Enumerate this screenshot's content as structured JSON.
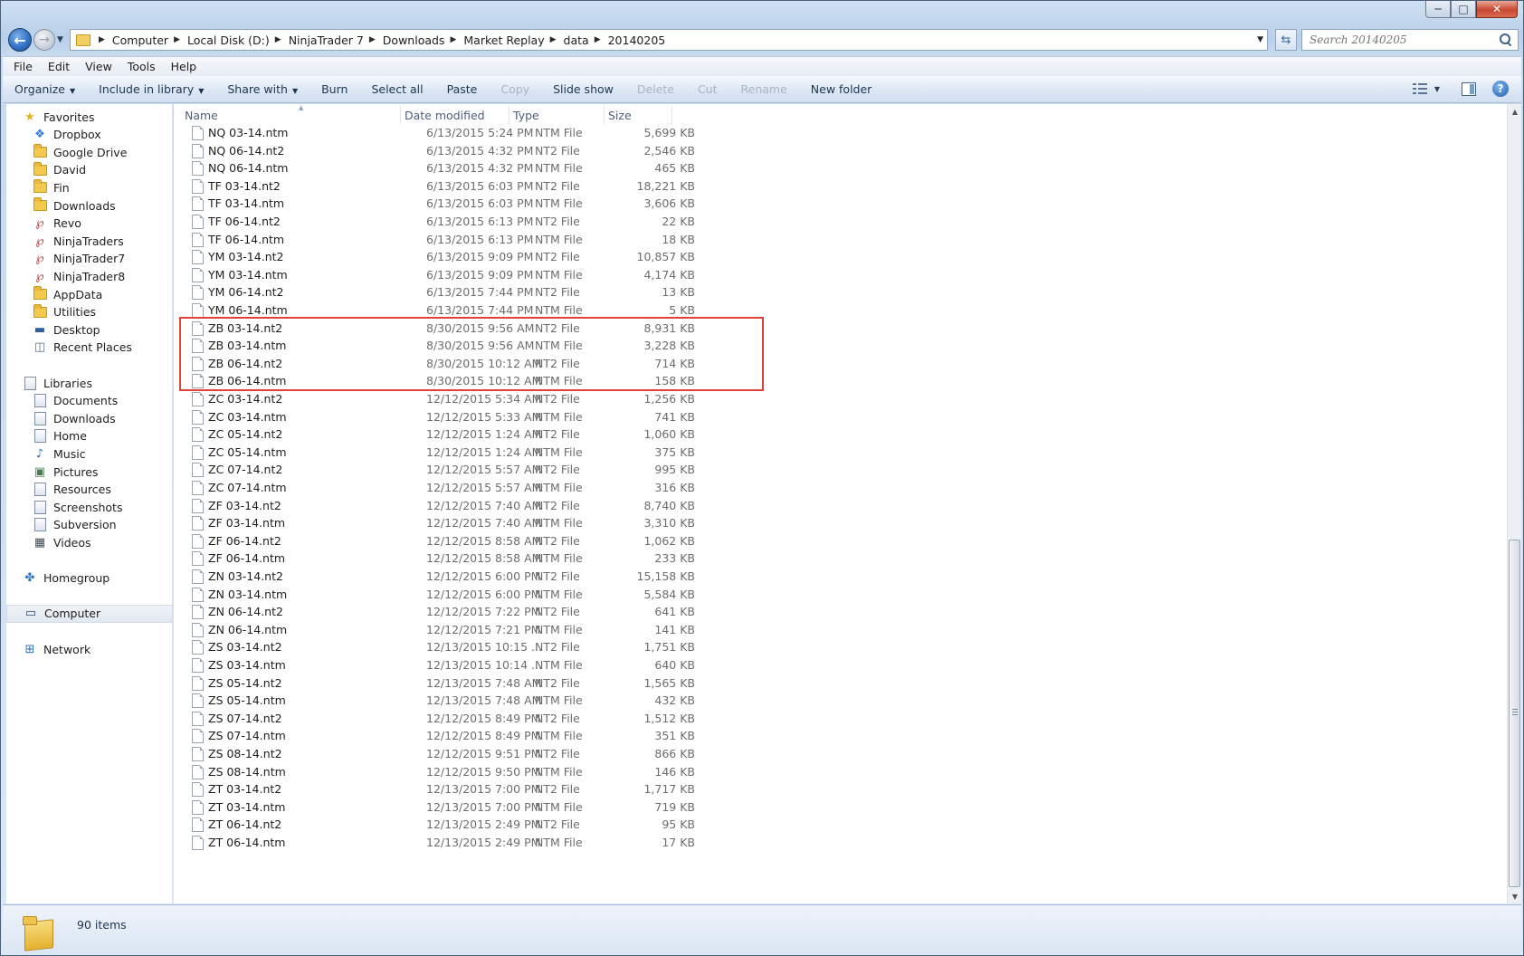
{
  "window": {
    "minimize": "─",
    "maximize": "□",
    "close": "✕"
  },
  "address": {
    "breadcrumbs": [
      "Computer",
      "Local Disk (D:)",
      "NinjaTrader 7",
      "Downloads",
      "Market Replay",
      "data",
      "20140205"
    ]
  },
  "search": {
    "placeholder": "Search 20140205"
  },
  "menu": [
    "File",
    "Edit",
    "View",
    "Tools",
    "Help"
  ],
  "toolbar": {
    "organize": "Organize",
    "include_in_library": "Include in library",
    "share_with": "Share with",
    "burn": "Burn",
    "select_all": "Select all",
    "paste": "Paste",
    "copy": "Copy",
    "slide_show": "Slide show",
    "delete": "Delete",
    "cut": "Cut",
    "rename": "Rename",
    "new_folder": "New folder"
  },
  "nav": {
    "favorites_header": "Favorites",
    "favorites": [
      "Dropbox",
      "Google Drive",
      "David",
      "Fin",
      "Downloads",
      "Revo",
      "NinjaTraders",
      "NinjaTrader7",
      "NinjaTrader8",
      "AppData",
      "Utilities",
      "Desktop",
      "Recent Places"
    ],
    "libraries_header": "Libraries",
    "libraries": [
      "Documents",
      "Downloads",
      "Home",
      "Music",
      "Pictures",
      "Resources",
      "Screenshots",
      "Subversion",
      "Videos"
    ],
    "homegroup": "Homegroup",
    "computer": "Computer",
    "network": "Network"
  },
  "columns": {
    "name": "Name",
    "date": "Date modified",
    "type": "Type",
    "size": "Size"
  },
  "files": [
    {
      "name": "NQ 03-14.ntm",
      "date": "6/13/2015 5:24 PM",
      "type": "NTM File",
      "size": "5,699 KB"
    },
    {
      "name": "NQ 06-14.nt2",
      "date": "6/13/2015 4:32 PM",
      "type": "NT2 File",
      "size": "2,546 KB"
    },
    {
      "name": "NQ 06-14.ntm",
      "date": "6/13/2015 4:32 PM",
      "type": "NTM File",
      "size": "465 KB"
    },
    {
      "name": "TF 03-14.nt2",
      "date": "6/13/2015 6:03 PM",
      "type": "NT2 File",
      "size": "18,221 KB"
    },
    {
      "name": "TF 03-14.ntm",
      "date": "6/13/2015 6:03 PM",
      "type": "NTM File",
      "size": "3,606 KB"
    },
    {
      "name": "TF 06-14.nt2",
      "date": "6/13/2015 6:13 PM",
      "type": "NT2 File",
      "size": "22 KB"
    },
    {
      "name": "TF 06-14.ntm",
      "date": "6/13/2015 6:13 PM",
      "type": "NTM File",
      "size": "18 KB"
    },
    {
      "name": "YM 03-14.nt2",
      "date": "6/13/2015 9:09 PM",
      "type": "NT2 File",
      "size": "10,857 KB"
    },
    {
      "name": "YM 03-14.ntm",
      "date": "6/13/2015 9:09 PM",
      "type": "NTM File",
      "size": "4,174 KB"
    },
    {
      "name": "YM 06-14.nt2",
      "date": "6/13/2015 7:44 PM",
      "type": "NT2 File",
      "size": "13 KB"
    },
    {
      "name": "YM 06-14.ntm",
      "date": "6/13/2015 7:44 PM",
      "type": "NTM File",
      "size": "5 KB"
    },
    {
      "name": "ZB 03-14.nt2",
      "date": "8/30/2015 9:56 AM",
      "type": "NT2 File",
      "size": "8,931 KB"
    },
    {
      "name": "ZB 03-14.ntm",
      "date": "8/30/2015 9:56 AM",
      "type": "NTM File",
      "size": "3,228 KB"
    },
    {
      "name": "ZB 06-14.nt2",
      "date": "8/30/2015 10:12 AM",
      "type": "NT2 File",
      "size": "714 KB"
    },
    {
      "name": "ZB 06-14.ntm",
      "date": "8/30/2015 10:12 AM",
      "type": "NTM File",
      "size": "158 KB"
    },
    {
      "name": "ZC 03-14.nt2",
      "date": "12/12/2015 5:34 AM",
      "type": "NT2 File",
      "size": "1,256 KB"
    },
    {
      "name": "ZC 03-14.ntm",
      "date": "12/12/2015 5:33 AM",
      "type": "NTM File",
      "size": "741 KB"
    },
    {
      "name": "ZC 05-14.nt2",
      "date": "12/12/2015 1:24 AM",
      "type": "NT2 File",
      "size": "1,060 KB"
    },
    {
      "name": "ZC 05-14.ntm",
      "date": "12/12/2015 1:24 AM",
      "type": "NTM File",
      "size": "375 KB"
    },
    {
      "name": "ZC 07-14.nt2",
      "date": "12/12/2015 5:57 AM",
      "type": "NT2 File",
      "size": "995 KB"
    },
    {
      "name": "ZC 07-14.ntm",
      "date": "12/12/2015 5:57 AM",
      "type": "NTM File",
      "size": "316 KB"
    },
    {
      "name": "ZF 03-14.nt2",
      "date": "12/12/2015 7:40 AM",
      "type": "NT2 File",
      "size": "8,740 KB"
    },
    {
      "name": "ZF 03-14.ntm",
      "date": "12/12/2015 7:40 AM",
      "type": "NTM File",
      "size": "3,310 KB"
    },
    {
      "name": "ZF 06-14.nt2",
      "date": "12/12/2015 8:58 AM",
      "type": "NT2 File",
      "size": "1,062 KB"
    },
    {
      "name": "ZF 06-14.ntm",
      "date": "12/12/2015 8:58 AM",
      "type": "NTM File",
      "size": "233 KB"
    },
    {
      "name": "ZN 03-14.nt2",
      "date": "12/12/2015 6:00 PM",
      "type": "NT2 File",
      "size": "15,158 KB"
    },
    {
      "name": "ZN 03-14.ntm",
      "date": "12/12/2015 6:00 PM",
      "type": "NTM File",
      "size": "5,584 KB"
    },
    {
      "name": "ZN 06-14.nt2",
      "date": "12/12/2015 7:22 PM",
      "type": "NT2 File",
      "size": "641 KB"
    },
    {
      "name": "ZN 06-14.ntm",
      "date": "12/12/2015 7:21 PM",
      "type": "NTM File",
      "size": "141 KB"
    },
    {
      "name": "ZS 03-14.nt2",
      "date": "12/13/2015 10:15 ...",
      "type": "NT2 File",
      "size": "1,751 KB"
    },
    {
      "name": "ZS 03-14.ntm",
      "date": "12/13/2015 10:14 ...",
      "type": "NTM File",
      "size": "640 KB"
    },
    {
      "name": "ZS 05-14.nt2",
      "date": "12/13/2015 7:48 AM",
      "type": "NT2 File",
      "size": "1,565 KB"
    },
    {
      "name": "ZS 05-14.ntm",
      "date": "12/13/2015 7:48 AM",
      "type": "NTM File",
      "size": "432 KB"
    },
    {
      "name": "ZS 07-14.nt2",
      "date": "12/12/2015 8:49 PM",
      "type": "NT2 File",
      "size": "1,512 KB"
    },
    {
      "name": "ZS 07-14.ntm",
      "date": "12/12/2015 8:49 PM",
      "type": "NTM File",
      "size": "351 KB"
    },
    {
      "name": "ZS 08-14.nt2",
      "date": "12/12/2015 9:51 PM",
      "type": "NT2 File",
      "size": "866 KB"
    },
    {
      "name": "ZS 08-14.ntm",
      "date": "12/12/2015 9:50 PM",
      "type": "NTM File",
      "size": "146 KB"
    },
    {
      "name": "ZT 03-14.nt2",
      "date": "12/13/2015 7:00 PM",
      "type": "NT2 File",
      "size": "1,717 KB"
    },
    {
      "name": "ZT 03-14.ntm",
      "date": "12/13/2015 7:00 PM",
      "type": "NTM File",
      "size": "719 KB"
    },
    {
      "name": "ZT 06-14.nt2",
      "date": "12/13/2015 2:49 PM",
      "type": "NT2 File",
      "size": "95 KB"
    },
    {
      "name": "ZT 06-14.ntm",
      "date": "12/13/2015 2:49 PM",
      "type": "NTM File",
      "size": "17 KB"
    }
  ],
  "highlight": {
    "color": "#e0433a",
    "first_row": 11,
    "row_count": 4
  },
  "status": {
    "items": "90 items"
  }
}
